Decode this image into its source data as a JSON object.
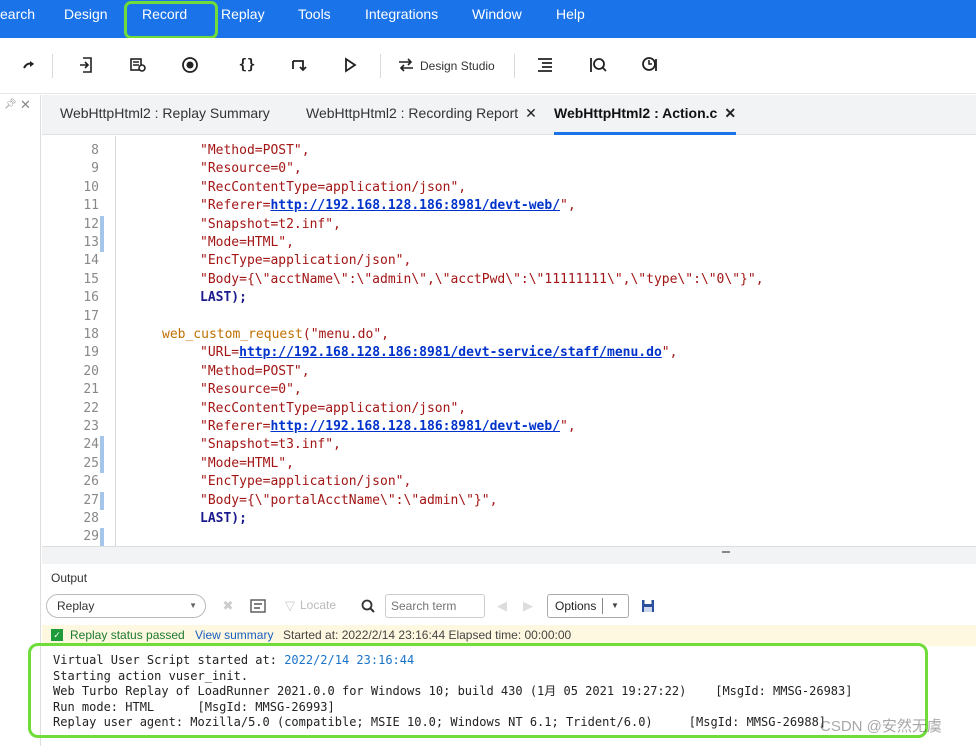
{
  "menu": {
    "items": [
      "earch",
      "Design",
      "Record",
      "Replay",
      "Tools",
      "Integrations",
      "Window",
      "Help"
    ],
    "highlighted": "Record"
  },
  "toolbar": {
    "design_studio_label": "Design Studio",
    "icons": [
      "redo-icon",
      "export-script-icon",
      "snapshot-icon",
      "record-icon",
      "braces-icon",
      "step-over-icon",
      "play-icon",
      "design-studio-icon",
      "list-icon",
      "search-run-icon",
      "run-status-icon"
    ]
  },
  "tabs": [
    {
      "label": "WebHttpHtml2 : Replay Summary",
      "closable": false,
      "active": false
    },
    {
      "label": "WebHttpHtml2 : Recording Report",
      "closable": true,
      "active": false
    },
    {
      "label": "WebHttpHtml2 : Action.c",
      "closable": true,
      "active": true
    }
  ],
  "editor": {
    "lines": [
      {
        "n": "8",
        "marker": false
      },
      {
        "n": "9",
        "marker": false
      },
      {
        "n": "10",
        "marker": false
      },
      {
        "n": "11",
        "marker": false
      },
      {
        "n": "12",
        "marker": true
      },
      {
        "n": "13",
        "marker": true
      },
      {
        "n": "14",
        "marker": false
      },
      {
        "n": "15",
        "marker": false
      },
      {
        "n": "16",
        "marker": false
      },
      {
        "n": "17",
        "marker": false
      },
      {
        "n": "18",
        "marker": false
      },
      {
        "n": "19",
        "marker": false
      },
      {
        "n": "20",
        "marker": false
      },
      {
        "n": "21",
        "marker": false
      },
      {
        "n": "22",
        "marker": false
      },
      {
        "n": "23",
        "marker": false
      },
      {
        "n": "24",
        "marker": true
      },
      {
        "n": "25",
        "marker": true
      },
      {
        "n": "26",
        "marker": false
      },
      {
        "n": "27",
        "marker": true
      },
      {
        "n": "28",
        "marker": false
      },
      {
        "n": "29",
        "marker": true
      }
    ],
    "code": {
      "l8": "\"Method=POST\",",
      "l9": "\"Resource=0\",",
      "l10": "\"RecContentType=application/json\",",
      "l11_pre": "\"Referer=",
      "l11_link": "http://192.168.128.186:8981/devt-web/",
      "l11_post": "\",",
      "l12": "\"Snapshot=t2.inf\",",
      "l13": "\"Mode=HTML\",",
      "l14": "\"EncType=application/json\",",
      "l15": "\"Body={\\\"acctName\\\":\\\"admin\\\",\\\"acctPwd\\\":\\\"11111111\\\",\\\"type\\\":\\\"0\\\"}\",",
      "l16": "LAST);",
      "l18_fn": "web_custom_request",
      "l18_arg": "(\"menu.do\",",
      "l19_pre": "\"URL=",
      "l19_link": "http://192.168.128.186:8981/devt-service/staff/menu.do",
      "l19_post": "\",",
      "l20": "\"Method=POST\",",
      "l21": "\"Resource=0\",",
      "l22": "\"RecContentType=application/json\",",
      "l23_pre": "\"Referer=",
      "l23_link": "http://192.168.128.186:8981/devt-web/",
      "l23_post": "\",",
      "l24": "\"Snapshot=t3.inf\",",
      "l25": "\"Mode=HTML\",",
      "l26": "\"EncType=application/json\",",
      "l27": "\"Body={\\\"portalAcctName\\\":\\\"admin\\\"}\",",
      "l28": "LAST);"
    }
  },
  "output": {
    "title": "Output",
    "combo_value": "Replay",
    "locate_label": "Locate",
    "search_placeholder": "Search term",
    "options_label": "Options",
    "status_passed": "Replay status passed",
    "view_summary": "View summary",
    "started": "Started at: 2022/2/14 23:16:44 Elapsed time: 00:00:00",
    "log": {
      "l1_pre": "Virtual User Script started at: ",
      "l1_val": "2022/2/14 23:16:44",
      "l2": "Starting action vuser_init.",
      "l3": "Web Turbo Replay of LoadRunner 2021.0.0 for Windows 10; build 430 (1月 05 2021 19:27:22)    [MsgId: MMSG-26983]",
      "l4": "Run mode: HTML      [MsgId: MMSG-26993]",
      "l5": "Replay user agent: Mozilla/5.0 (compatible; MSIE 10.0; Windows NT 6.1; Trident/6.0)     [MsgId: MMSG-26988]"
    }
  },
  "watermark": "CSDN @安然无虞",
  "colors": {
    "menubar": "#1a73e8",
    "highlight": "#6fdc3a",
    "status_bg": "#fff8e0"
  }
}
